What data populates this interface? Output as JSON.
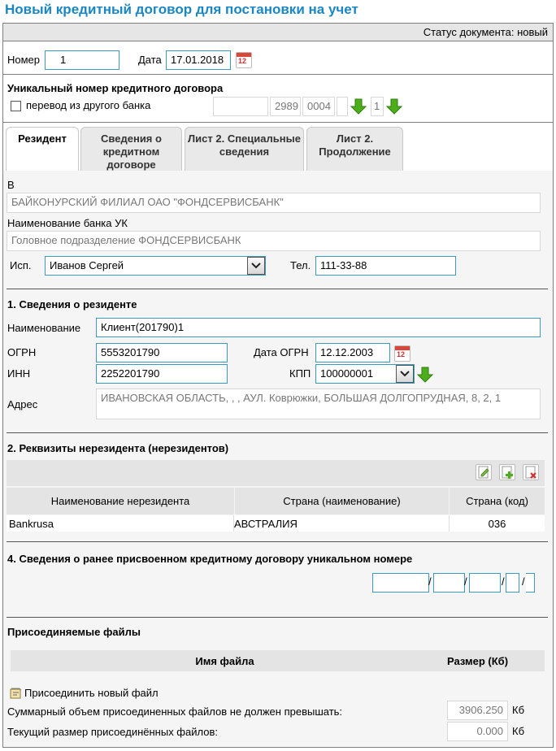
{
  "title": "Новый кредитный договор для постановки на учет",
  "status": "Статус документа: новый",
  "header": {
    "number_label": "Номер",
    "number_value": "1",
    "date_label": "Дата",
    "date_value": "17.01.2018"
  },
  "unique": {
    "heading": "Уникальный номер кредитного договора",
    "checkbox_label": "перевод из другого банка",
    "parts": [
      "",
      "2989",
      "0004",
      "",
      "1"
    ]
  },
  "tabs": [
    {
      "label": "Резидент"
    },
    {
      "label": "Сведения о кредитном договоре"
    },
    {
      "label": "Лист 2. Специальные сведения"
    },
    {
      "label": "Лист 2. Продолжение"
    }
  ],
  "bank": {
    "b_label": "В",
    "b_value": "БАЙКОНУРСКИЙ ФИЛИАЛ ОАО \"ФОНДСЕРВИСБАНК\"",
    "uk_label": "Наименование банка УК",
    "uk_value": "Головное подразделение ФОНДСЕРВИСБАНК",
    "isp_label": "Исп.",
    "isp_value": "Иванов Сергей",
    "tel_label": "Тел.",
    "tel_value": "111-33-88"
  },
  "resident": {
    "heading": "1. Сведения о резиденте",
    "name_label": "Наименование",
    "name_value": "Клиент(201790)1",
    "ogrn_label": "ОГРН",
    "ogrn_value": "5553201790",
    "ogrn_date_label": "Дата ОГРН",
    "ogrn_date_value": "12.12.2003",
    "inn_label": "ИНН",
    "inn_value": "2252201790",
    "kpp_label": "КПП",
    "kpp_value": "100000001",
    "address_label": "Адрес",
    "address_value": "ИВАНОВСКАЯ ОБЛАСТЬ, , , АУЛ. Коврюжки, БОЛЬШАЯ ДОЛГОПРУДНАЯ, 8, 2, 1"
  },
  "nonresident": {
    "heading": "2. Реквизиты нерезидента (нерезидентов)",
    "columns": [
      "Наименование нерезидента",
      "Страна (наименование)",
      "Страна (код)"
    ],
    "rows": [
      [
        "Bankrusa",
        "АВСТРАЛИЯ",
        "036"
      ]
    ]
  },
  "prior": {
    "heading": "4. Сведения о ранее присвоенном кредитному договору уникальном номере",
    "separators": [
      "/",
      "/",
      "/",
      "/"
    ]
  },
  "files": {
    "heading": "Присоединяемые файлы",
    "col_name": "Имя файла",
    "col_size": "Размер (Кб)",
    "attach_label": "Присоединить новый файл",
    "limit_label": "Суммарный объем присоединенных файлов не должен превышать:",
    "limit_value": "3906.250",
    "current_label": "Текущий размер присоединённых файлов:",
    "current_value": "0.000",
    "unit": "Кб"
  },
  "colors": {
    "accent": "#1a87c4",
    "input_border": "#3a9bbd",
    "arrow": "#4caf1a",
    "calendar": "#d9463a"
  },
  "icons": [
    "calendar-icon",
    "green-arrow-down-icon",
    "edit-icon",
    "add-icon",
    "delete-icon",
    "attach-file-icon",
    "chevron-down-icon"
  ]
}
